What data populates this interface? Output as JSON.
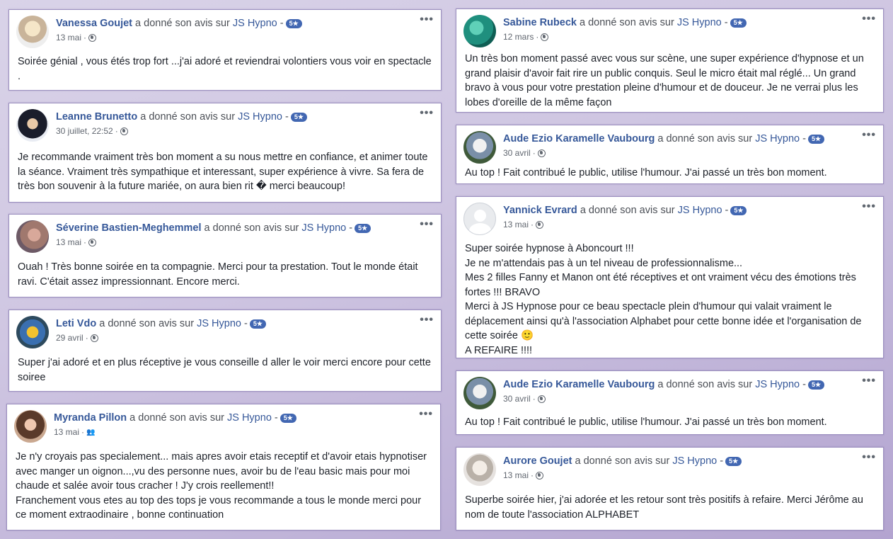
{
  "action_text": "a donné son avis sur",
  "page_name": "JS Hypno",
  "dash": " -",
  "badge": "5★",
  "reviews": [
    {
      "name": "Vanessa Goujet",
      "date": "13 mai",
      "privacy_icon": "globe-icon",
      "text": "Soirée génial , vous étés trop fort ...j'ai adoré et reviendrai volontiers vous voir en spectacle ."
    },
    {
      "name": "Leanne Brunetto",
      "date": "30 juillet, 22:52",
      "privacy_icon": "globe-icon",
      "text": "Je recommande vraiment très bon moment a su nous mettre en confiance, et animer toute la séance. Vraiment très sympathique et interessant, super expérience à vivre. Sa fera de très bon souvenir à la future mariée, on aura bien rit � merci beaucoup!"
    },
    {
      "name": "Séverine Bastien-Meghemmel",
      "date": "13 mai",
      "privacy_icon": "globe-icon",
      "text": "Ouah ! Très bonne soirée en ta compagnie. Merci pour ta prestation. Tout le monde était ravi. C'était assez impressionnant. Encore merci."
    },
    {
      "name": "Leti Vdo",
      "date": "29 avril",
      "privacy_icon": "globe-icon",
      "text": "Super j'ai adoré et en plus réceptive je vous conseille d aller le voir merci encore pour cette soiree"
    },
    {
      "name": "Myranda Pillon",
      "date": "13 mai",
      "privacy_icon": "friends-icon",
      "text": "Je n'y croyais pas specialement... mais apres avoir etais receptif et d'avoir etais hypnotiser avec manger un oignon...,vu des personne nues, avoir bu de l'eau basic mais pour moi chaude et salée avoir tous cracher ! J'y crois reellement!!\nFranchement vous etes au top des tops je vous recommande a tous le monde merci pour ce moment extraodinaire , bonne continuation"
    },
    {
      "name": "Sabine Rubeck",
      "date": "12 mars",
      "privacy_icon": "globe-icon",
      "text": "Un très bon moment passé avec vous sur scène, une super expérience d'hypnose et un grand plaisir d'avoir fait rire un public conquis. Seul le micro était mal réglé... Un grand bravo à vous pour votre prestation pleine d'humour et de douceur. Je ne verrai plus les lobes d'oreille de la même façon"
    },
    {
      "name": "Aude Ezio Karamelle Vaubourg",
      "date": "30 avril",
      "privacy_icon": "globe-icon",
      "text": "Au top ! Fait contribué le public, utilise l'humour. J'ai passé un très bon moment."
    },
    {
      "name": "Yannick Evrard",
      "date": "13 mai",
      "privacy_icon": "globe-icon",
      "text": "Super soirée hypnose à Aboncourt !!!\nJe ne m'attendais pas à un tel niveau de professionnalisme...\nMes 2 filles Fanny et Manon ont été réceptives et ont vraiment vécu des émotions très fortes !!! BRAVO\nMerci à JS Hypnose pour ce beau spectacle plein d'humour qui valait vraiment le déplacement ainsi qu'à l'association Alphabet pour cette bonne idée et l'organisation de cette soirée 🙂\nA REFAIRE !!!!"
    },
    {
      "name": "Aude Ezio Karamelle Vaubourg",
      "date": "30 avril",
      "privacy_icon": "globe-icon",
      "text": "Au top ! Fait contribué le public, utilise l'humour. J'ai passé un très bon moment."
    },
    {
      "name": "Aurore Goujet",
      "date": "13 mai",
      "privacy_icon": "globe-icon",
      "text": "Superbe soirée hier, j'ai adorée et les retour sont très positifs à refaire. Merci Jérôme au nom de toute l'association ALPHABET"
    }
  ]
}
